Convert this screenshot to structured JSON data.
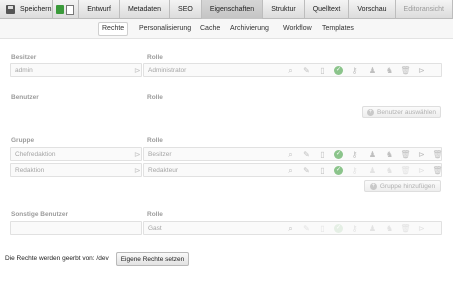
{
  "toolbar": {
    "save_label": "Speichern",
    "tabs": [
      "Entwurf",
      "Metadaten",
      "SEO",
      "Eigenschaften",
      "Struktur",
      "Quelltext",
      "Vorschau",
      "Editoransicht"
    ]
  },
  "subnav": {
    "items": [
      "Rechte",
      "Personalisierung",
      "Cache",
      "Archivierung",
      "Workflow",
      "Templates"
    ]
  },
  "owner": {
    "label": "Besitzer",
    "role_label": "Rolle",
    "user": "admin",
    "role": "Administrator"
  },
  "users": {
    "label": "Benutzer",
    "role_label": "Rolle",
    "add_button": "Benutzer auswählen"
  },
  "groups": {
    "label": "Gruppe",
    "role_label": "Rolle",
    "rows": [
      {
        "name": "Chefredaktion",
        "role": "Besitzer"
      },
      {
        "name": "Redaktion",
        "role": "Redakteur"
      }
    ],
    "add_button": "Gruppe hinzufügen"
  },
  "others": {
    "label": "Sonstige Benutzer",
    "role_label": "Rolle",
    "role": "Gast"
  },
  "footer": {
    "inherit_text": "Die Rechte werden geerbt von: /dev",
    "own_rights_button": "Eigene Rechte setzen"
  },
  "colors": {
    "accent_check": "#8bc48b",
    "toolbar_active": "#c4c4c4"
  }
}
